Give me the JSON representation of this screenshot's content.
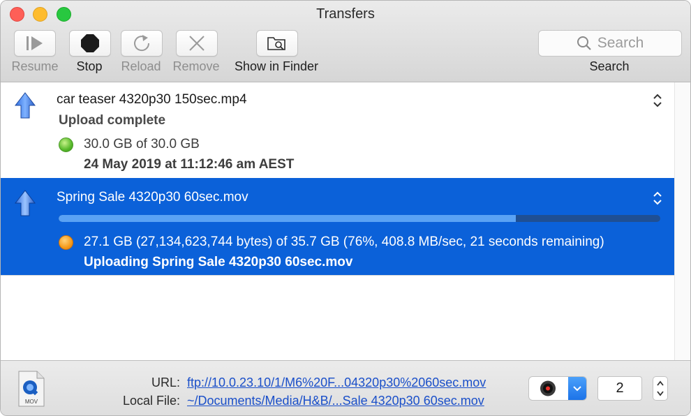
{
  "window": {
    "title": "Transfers"
  },
  "toolbar": {
    "resume_label": "Resume",
    "stop_label": "Stop",
    "reload_label": "Reload",
    "remove_label": "Remove",
    "show_in_finder_label": "Show in Finder",
    "search_placeholder": "Search",
    "search_label": "Search"
  },
  "transfers": [
    {
      "filename": "car teaser 4320p30 150sec.mp4",
      "status": "Upload complete",
      "size_text": "30.0 GB of 30.0 GB",
      "detail": "24 May 2019 at 11:12:46 am AEST",
      "indicator_color": "#56b82a",
      "selected": false
    },
    {
      "filename": "Spring Sale 4320p30 60sec.mov",
      "progress": 0.76,
      "size_text": "27.1 GB (27,134,623,744 bytes) of 35.7 GB (76%, 408.8 MB/sec, 21 seconds remaining)",
      "detail": "Uploading Spring Sale 4320p30 60sec.mov",
      "indicator_color": "#f59a1a",
      "selected": true
    }
  ],
  "bottom": {
    "url_label": "URL:",
    "url_value": "ftp://10.0.23.10/1/M6%20F...04320p30%2060sec.mov",
    "local_file_label": "Local File:",
    "local_file_value": "~/Documents/Media/H&B/...Sale 4320p30 60sec.mov",
    "file_icon_label": "MOV",
    "connections_value": "2"
  },
  "colors": {
    "selection": "#0b61d9",
    "link": "#1a4fc9",
    "progress_fill": "#5aa2f4"
  }
}
